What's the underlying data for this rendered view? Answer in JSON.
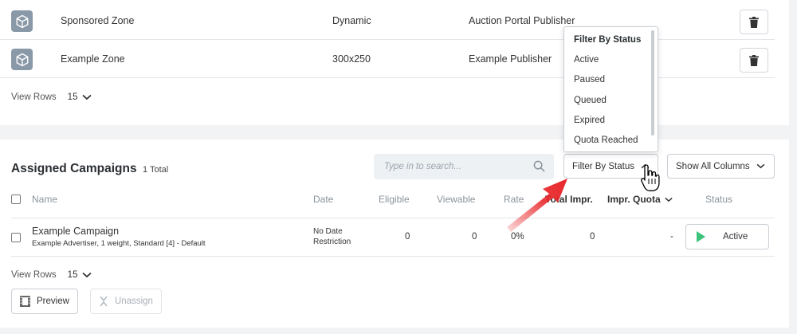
{
  "zones": {
    "rows": [
      {
        "name": "Sponsored Zone",
        "size": "Dynamic",
        "publisher": "Auction Portal Publisher"
      },
      {
        "name": "Example Zone",
        "size": "300x250",
        "publisher": "Example Publisher"
      }
    ],
    "view_rows_label": "View Rows",
    "view_rows_value": "15"
  },
  "campaigns": {
    "title": "Assigned Campaigns",
    "count": "1 Total",
    "search_placeholder": "Type in to search...",
    "filter_label": "Filter By Status",
    "columns_label": "Show All Columns",
    "headers": {
      "name": "Name",
      "date": "Date",
      "eligible": "Eligible",
      "viewable": "Viewable",
      "rate": "Rate",
      "total_impr": "Total Impr.",
      "impr_quota": "Impr. Quota",
      "status": "Status"
    },
    "rows": [
      {
        "name": "Example Campaign",
        "sub": "Example Advertiser, 1 weight, Standard [4] - Default",
        "date": "No Date Restriction",
        "eligible": "0",
        "viewable": "0",
        "rate": "0%",
        "total_impr": "0",
        "impr_quota": "-",
        "status": "Active"
      }
    ],
    "view_rows_label": "View Rows",
    "view_rows_value": "15",
    "preview_label": "Preview",
    "unassign_label": "Unassign"
  },
  "filter_dropdown": {
    "heading": "Filter By Status",
    "options": [
      "Active",
      "Paused",
      "Queued",
      "Expired",
      "Quota Reached"
    ]
  },
  "colors": {
    "accent_green": "#3cc47c",
    "arrow_red": "#e8262a",
    "icon_slate": "#8a99a8"
  }
}
